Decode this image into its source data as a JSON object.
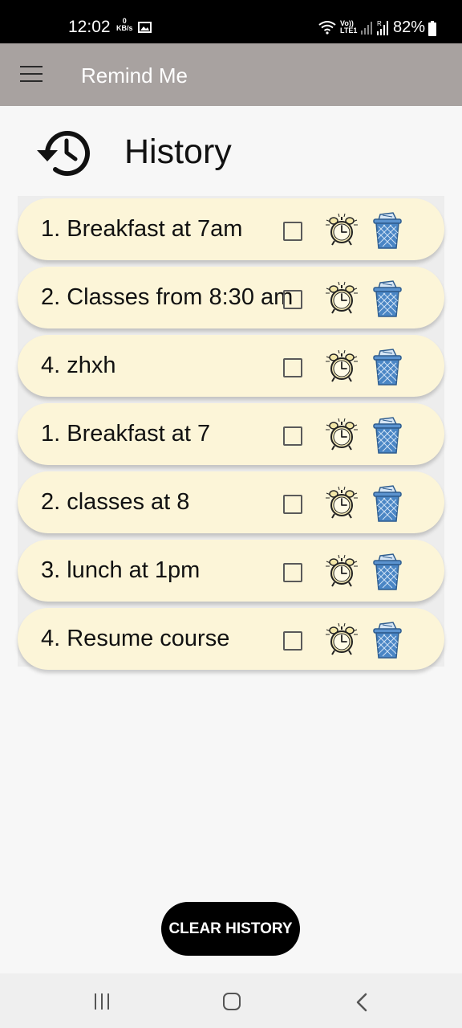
{
  "status_bar": {
    "time": "12:02",
    "net_speed_value": "0",
    "net_speed_unit": "KB/s",
    "lte_label_top": "Vo))",
    "lte_label_bottom": "LTE1",
    "battery": "82%"
  },
  "app_bar": {
    "title": "Remind Me",
    "menu_icon": "hamburger-menu-icon"
  },
  "page": {
    "title": "History",
    "icon": "history-icon"
  },
  "reminders": [
    {
      "text": "1. Breakfast at 7am",
      "checked": false
    },
    {
      "text": "2. Classes from 8:30 am",
      "checked": false
    },
    {
      "text": "4. zhxh",
      "checked": false
    },
    {
      "text": "1. Breakfast at 7",
      "checked": false
    },
    {
      "text": "2. classes at 8",
      "checked": false
    },
    {
      "text": "3. lunch at 1pm",
      "checked": false
    },
    {
      "text": "4. Resume course",
      "checked": false
    }
  ],
  "clear_button": {
    "label": "CLEAR HISTORY"
  },
  "colors": {
    "app_bar": "#a8a2a0",
    "item_background": "#fcf5d8",
    "button": "#000000",
    "trash_icon": "#4a86c5"
  }
}
